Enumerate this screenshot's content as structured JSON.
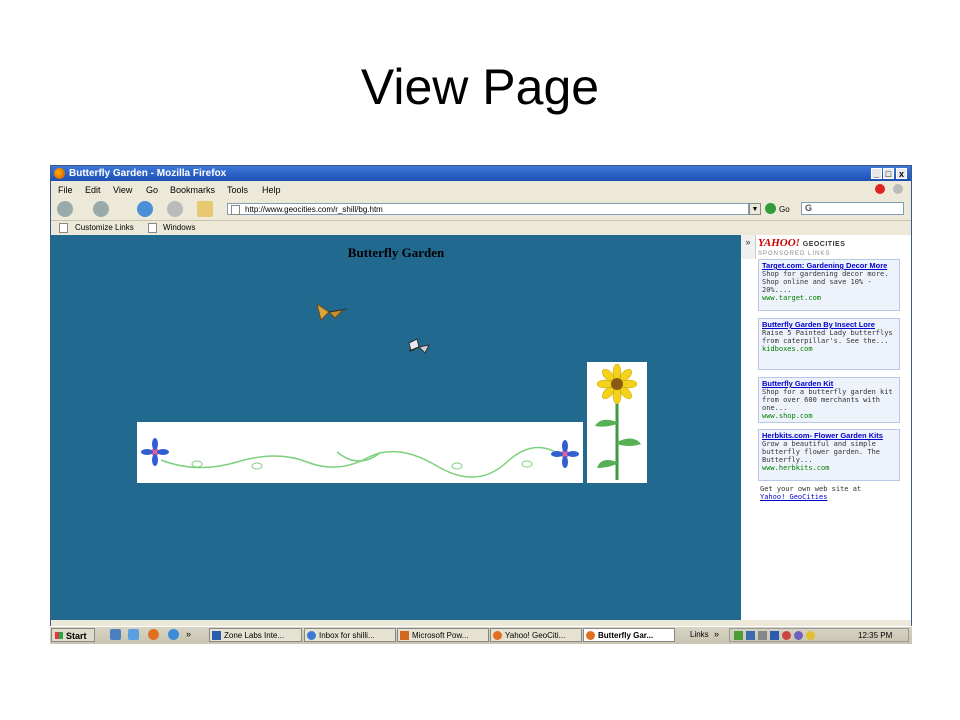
{
  "slide": {
    "title": "View Page"
  },
  "window": {
    "title": "Butterfly Garden - Mozilla Firefox",
    "controls": {
      "minimize": "_",
      "maximize": "□",
      "close": "x"
    }
  },
  "menu": [
    "File",
    "Edit",
    "View",
    "Go",
    "Bookmarks",
    "Tools",
    "Help"
  ],
  "navbar": {
    "url": "http://www.geocities.com/r_shill/bg.htm",
    "go_label": "Go",
    "search_value": "G"
  },
  "bookmarks": [
    "Customize Links",
    "Windows"
  ],
  "page": {
    "heading": "Butterfly Garden"
  },
  "sidebar": {
    "collapse": "»",
    "brand_yahoo": "YAHOO!",
    "brand_geo": "GEOCITIES",
    "sponsored": "SPONSORED LINKS",
    "ads": [
      {
        "title": "Target.com: Gardening Decor More",
        "desc": "Shop for gardening decor more. Shop online and save 10% - 20%....",
        "site": "www.target.com"
      },
      {
        "title": "Butterfly Garden By Insect Lore",
        "desc": "Raise 5 Painted Lady butterflys from caterpillar's. See the...",
        "site": "kidboxes.com"
      },
      {
        "title": "Butterfly Garden Kit",
        "desc": "Shop for a butterfly garden kit from over 600 merchants with one...",
        "site": "www.shop.com"
      },
      {
        "title": "Herbkits.com- Flower Garden Kits",
        "desc": "Grow a beautiful and simple butterfly flower garden. The Butterfly...",
        "site": "www.herbkits.com"
      }
    ],
    "get_site_text": "Get your own web site at",
    "get_site_link": "Yahoo! GeoCities"
  },
  "taskbar": {
    "start": "Start",
    "quicklaunch_more": "»",
    "tasks": [
      {
        "label": "Zone Labs Inte...",
        "icon_color": "#2a5db0"
      },
      {
        "label": "Inbox for shilli...",
        "icon_color": "#3a7bd5"
      },
      {
        "label": "Microsoft Pow...",
        "icon_color": "#d2691e"
      },
      {
        "label": "Yahoo! GeoCiti...",
        "icon_color": "#e07020"
      },
      {
        "label": "Butterfly Gar...",
        "icon_color": "#e07020"
      }
    ],
    "links_label": "Links",
    "links_more": "»",
    "clock": "12:35 PM"
  },
  "colors": {
    "content_bg": "#21698f",
    "titlebar": "#1d4fb3",
    "ad_link": "#0000cc",
    "ad_site": "#008000"
  }
}
